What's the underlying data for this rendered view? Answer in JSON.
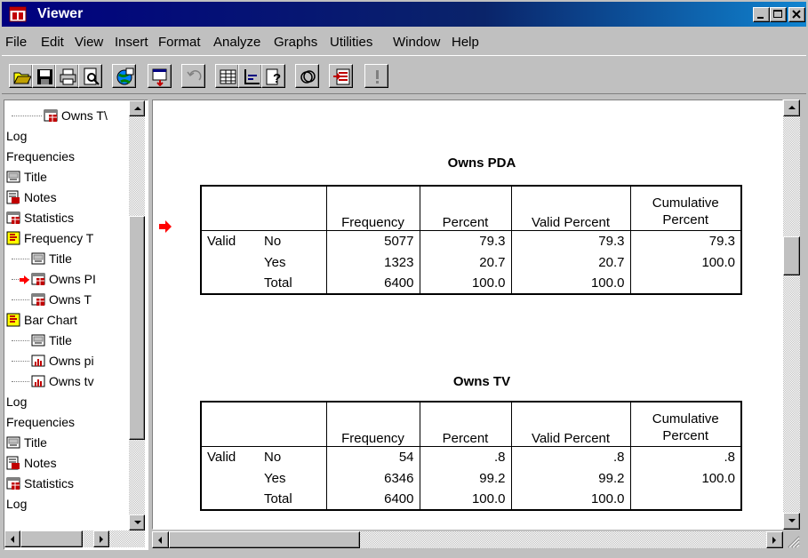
{
  "window": {
    "title": "Viewer"
  },
  "menu": [
    "File",
    "Edit",
    "View",
    "Insert",
    "Format",
    "Analyze",
    "Graphs",
    "Utilities",
    "Window",
    "Help"
  ],
  "outline": [
    {
      "label": "Owns T\\",
      "icon": "table-icon",
      "indent": 2
    },
    {
      "label": "Log",
      "icon": "",
      "indent": 0
    },
    {
      "label": "Frequencies",
      "icon": "",
      "indent": 0
    },
    {
      "label": "Title",
      "icon": "title-icon",
      "indent": 0
    },
    {
      "label": "Notes",
      "icon": "notes-icon",
      "indent": 0
    },
    {
      "label": "Statistics",
      "icon": "table-icon",
      "indent": 0
    },
    {
      "label": "Frequency T",
      "icon": "book-icon",
      "indent": 0
    },
    {
      "label": "Title",
      "icon": "title-icon",
      "indent": 1
    },
    {
      "label": "Owns PI",
      "icon": "table-icon",
      "indent": 1,
      "selected": true
    },
    {
      "label": "Owns T",
      "icon": "table-icon",
      "indent": 1
    },
    {
      "label": "Bar Chart",
      "icon": "book-icon",
      "indent": 0
    },
    {
      "label": "Title",
      "icon": "title-icon",
      "indent": 1
    },
    {
      "label": "Owns pi",
      "icon": "chart-icon",
      "indent": 1
    },
    {
      "label": "Owns tv",
      "icon": "chart-icon",
      "indent": 1
    },
    {
      "label": "Log",
      "icon": "",
      "indent": 0
    },
    {
      "label": "Frequencies",
      "icon": "",
      "indent": 0
    },
    {
      "label": "Title",
      "icon": "title-icon",
      "indent": 0
    },
    {
      "label": "Notes",
      "icon": "notes-icon",
      "indent": 0
    },
    {
      "label": "Statistics",
      "icon": "table-icon",
      "indent": 0
    },
    {
      "label": "Log",
      "icon": "",
      "indent": 0
    }
  ],
  "headers": [
    "Frequency",
    "Percent",
    "Valid Percent",
    "Cumulative",
    "Percent"
  ],
  "tables": [
    {
      "title": "Owns PDA",
      "valid": "Valid",
      "rows": [
        {
          "label": "No",
          "freq": "5077",
          "pct": "79.3",
          "vpct": "79.3",
          "cpct": "79.3"
        },
        {
          "label": "Yes",
          "freq": "1323",
          "pct": "20.7",
          "vpct": "20.7",
          "cpct": "100.0"
        },
        {
          "label": "Total",
          "freq": "6400",
          "pct": "100.0",
          "vpct": "100.0",
          "cpct": ""
        }
      ]
    },
    {
      "title": "Owns TV",
      "valid": "Valid",
      "rows": [
        {
          "label": "No",
          "freq": "54",
          "pct": ".8",
          "vpct": ".8",
          "cpct": ".8"
        },
        {
          "label": "Yes",
          "freq": "6346",
          "pct": "99.2",
          "vpct": "99.2",
          "cpct": "100.0"
        },
        {
          "label": "Total",
          "freq": "6400",
          "pct": "100.0",
          "vpct": "100.0",
          "cpct": ""
        }
      ]
    }
  ],
  "colors": {
    "titlebar": "#000080",
    "accent_arrow": "#ff0000",
    "face": "#c0c0c0"
  }
}
